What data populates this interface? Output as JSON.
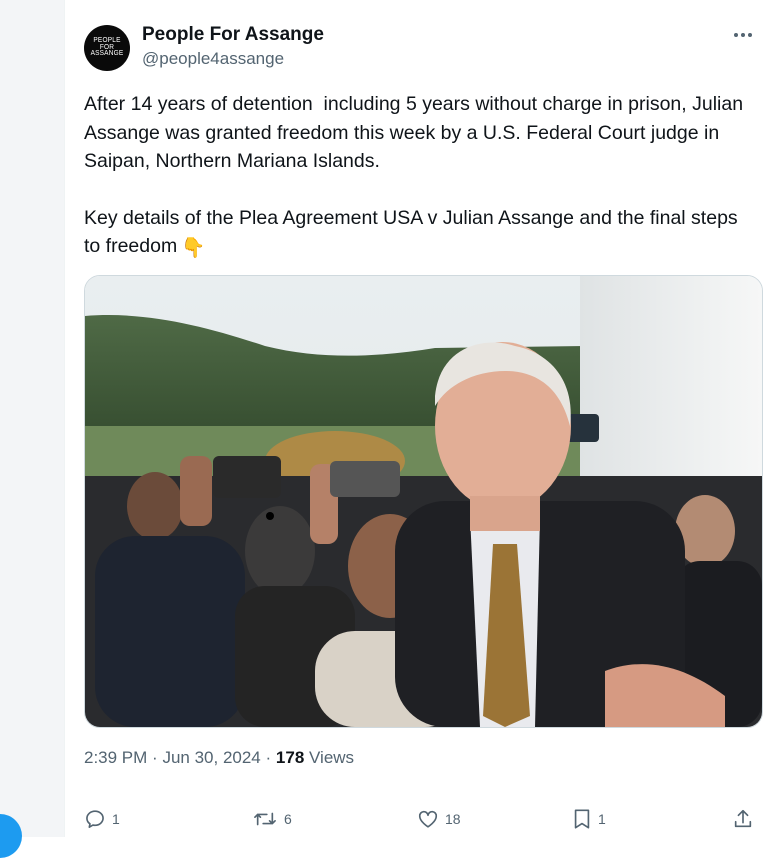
{
  "author": {
    "name": "People For Assange",
    "handle": "@people4assange",
    "avatar_text": [
      "PEOPLE",
      "FOR",
      "ASSANGE"
    ]
  },
  "tweet": {
    "paragraph1": "After 14 years of detention  including 5 years without charge in prison, Julian Assange was granted freedom this week by a U.S. Federal Court judge in Saipan, Northern Mariana Islands.",
    "paragraph2": "Key details of the Plea Agreement USA v Julian Assange and the final steps to freedom",
    "emoji": "👇"
  },
  "meta": {
    "time": "2:39 PM",
    "separator": "·",
    "date": "Jun 30, 2024",
    "views_count": "178",
    "views_label": "Views"
  },
  "actions": {
    "replies": "1",
    "reposts": "6",
    "likes": "18",
    "bookmarks": "1"
  },
  "colors": {
    "text": "#0f1419",
    "secondary": "#536471",
    "accent": "#1d9bf0",
    "border": "#cfd9de"
  },
  "icons": [
    "more-icon",
    "reply-icon",
    "repost-icon",
    "like-icon",
    "bookmark-icon",
    "share-icon"
  ]
}
